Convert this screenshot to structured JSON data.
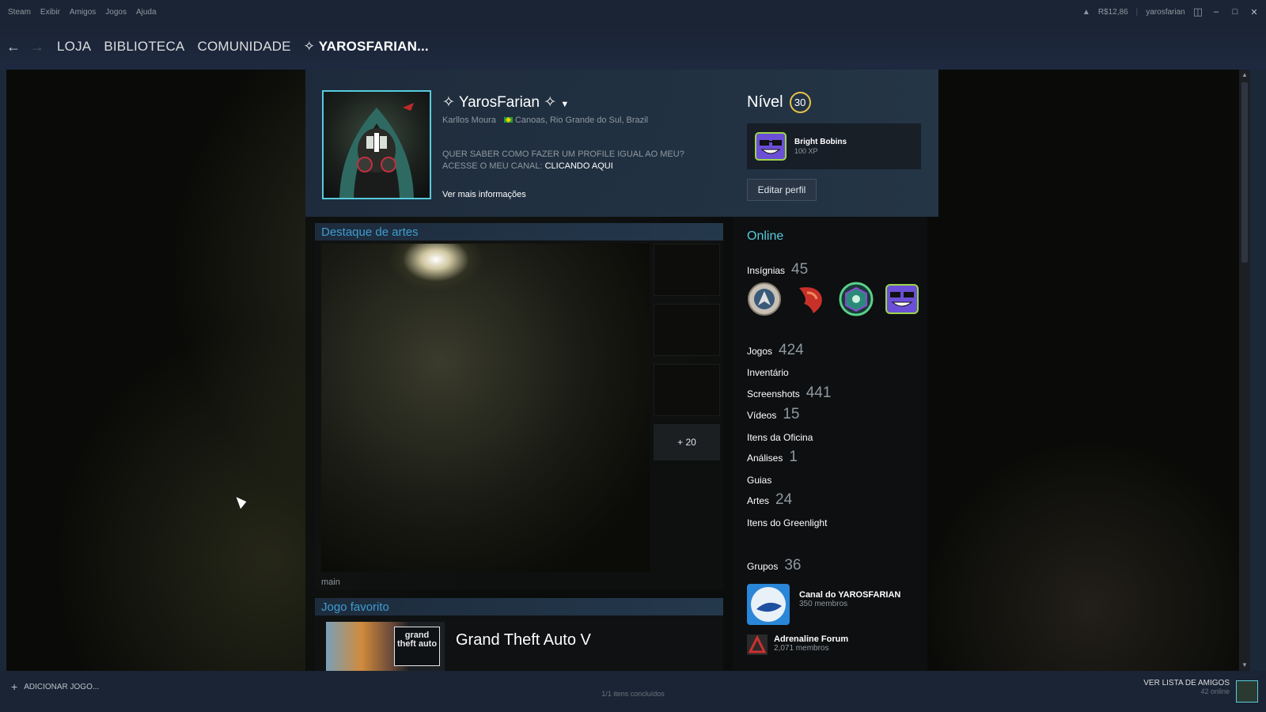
{
  "menu": [
    "Steam",
    "Exibir",
    "Amigos",
    "Jogos",
    "Ajuda"
  ],
  "titlebar": {
    "wallet": "R$12,86",
    "account": "yarosfarian"
  },
  "nav": {
    "store": "LOJA",
    "library": "BIBLIOTECA",
    "community": "COMUNIDADE",
    "profile": "✧ YAROSFARIAN..."
  },
  "profile": {
    "persona": "✧ YarosFarian ✧",
    "real_name": "Karllos Moura",
    "location": "Canoas, Rio Grande do Sul, Brazil",
    "summary_line1": "QUER SABER COMO FAZER UM PROFILE IGUAL AO MEU?",
    "summary_line2": "ACESSE O MEU CANAL: ",
    "summary_link": "CLICANDO AQUI",
    "more_info": "Ver mais informações",
    "level_label": "Nível",
    "level": "30",
    "favorite_badge": {
      "name": "Bright Bobins",
      "xp": "100 XP"
    },
    "edit_button": "Editar perfil"
  },
  "artwork": {
    "header": "Destaque de artes",
    "more": "+ 20",
    "caption": "main"
  },
  "favorite_game": {
    "header": "Jogo favorito",
    "name": "Grand Theft Auto V",
    "logo_text": "grand theft auto"
  },
  "sidebar": {
    "status": "Online",
    "badges_label": "Insígnias",
    "badges_count": "45",
    "stats": [
      {
        "label": "Jogos",
        "count": "424"
      },
      {
        "label": "Inventário",
        "count": ""
      },
      {
        "label": "Screenshots",
        "count": "441"
      },
      {
        "label": "Vídeos",
        "count": "15"
      },
      {
        "label": "Itens da Oficina",
        "count": ""
      },
      {
        "label": "Análises",
        "count": "1"
      },
      {
        "label": "Guias",
        "count": ""
      },
      {
        "label": "Artes",
        "count": "24"
      },
      {
        "label": "Itens do Greenlight",
        "count": ""
      }
    ],
    "groups_label": "Grupos",
    "groups_count": "36",
    "groups": [
      {
        "name": "Canal do YAROSFARIAN",
        "members": "350 membros"
      },
      {
        "name": "Adrenaline Forum",
        "members": "2,071 membros"
      }
    ]
  },
  "bottombar": {
    "add_game": "ADICIONAR JOGO...",
    "downloads": "1/1 itens concluídos",
    "friends_list": "VER LISTA DE AMIGOS",
    "friends_online": "42 online"
  },
  "colors": {
    "accent": "#57cbde",
    "header_blue": "#3f9cd0",
    "level_ring": "#e7c34a"
  }
}
